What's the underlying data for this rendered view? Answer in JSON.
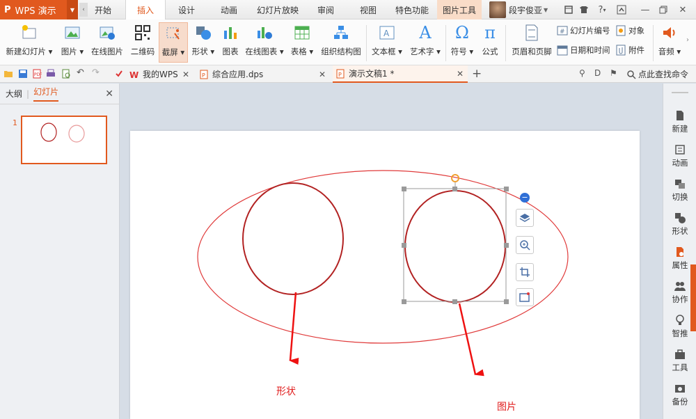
{
  "app": {
    "logo": "P",
    "name": "WPS 演示"
  },
  "menu_tabs": [
    {
      "label": "开始"
    },
    {
      "label": "插入"
    },
    {
      "label": "设计"
    },
    {
      "label": "动画"
    },
    {
      "label": "幻灯片放映"
    },
    {
      "label": "审阅"
    },
    {
      "label": "视图"
    },
    {
      "label": "特色功能"
    },
    {
      "label": "图片工具"
    }
  ],
  "active_tab": "插入",
  "user": {
    "name": "段宇俊亚"
  },
  "ribbon": {
    "new_slide": "新建幻灯片",
    "picture": "图片",
    "online_picture": "在线图片",
    "qrcode": "二维码",
    "screenshot": "截屏",
    "shape": "形状",
    "chart": "图表",
    "online_chart": "在线图表",
    "table": "表格",
    "org_chart": "组织结构图",
    "textbox": "文本框",
    "wordart": "艺术字",
    "symbol": "符号",
    "formula": "公式",
    "header_footer": "页眉和页脚",
    "slide_number": "幻灯片编号",
    "object": "对象",
    "date_time": "日期和时间",
    "attachment": "附件",
    "audio": "音频",
    "symbol_glyph": "Ω",
    "formula_glyph": "π",
    "wordart_glyph": "A"
  },
  "doc_tabs": [
    {
      "label": "我的WPS"
    },
    {
      "label": "综合应用.dps"
    },
    {
      "label": "演示文稿1 *"
    }
  ],
  "search_command": "点此查找命令",
  "left_panel": {
    "tab_outline": "大纲",
    "tab_slides": "幻灯片",
    "slide_number": "1"
  },
  "slide": {
    "label_shape": "形状",
    "label_picture": "图片"
  },
  "colors": {
    "accent": "#e1591e",
    "annotation_red": "#e01b1b",
    "circle_red": "#b22222"
  },
  "right_bar": [
    {
      "label": "新建"
    },
    {
      "label": "动画"
    },
    {
      "label": "切换"
    },
    {
      "label": "形状"
    },
    {
      "label": "属性"
    },
    {
      "label": "协作"
    },
    {
      "label": "智推"
    },
    {
      "label": "工具"
    },
    {
      "label": "备份"
    }
  ]
}
